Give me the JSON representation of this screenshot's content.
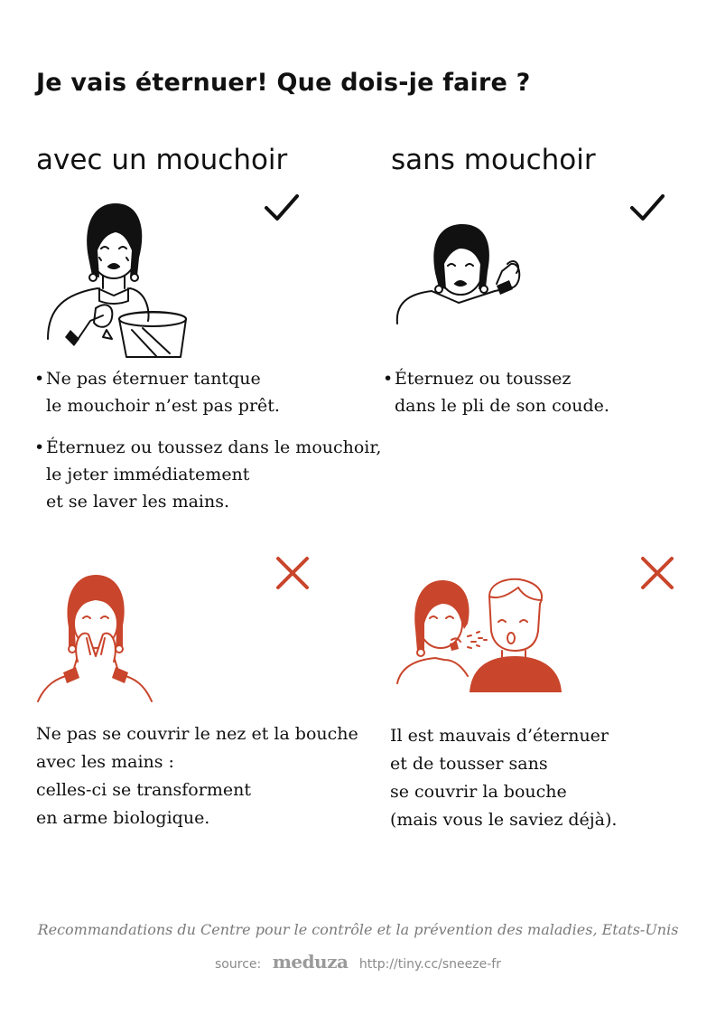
{
  "title": "Je vais éternuer! Que dois-je faire ?",
  "colors": {
    "ink": "#111111",
    "accent": "#c9452b",
    "muted": "#7a7a7a"
  },
  "with_tissue": {
    "heading": "avec un mouchoir",
    "mark_icon": "checkmark-icon",
    "illustration_icon": "woman-sneezing-holding-tissue-over-bin-icon",
    "tips": [
      {
        "line1": "Ne pas éternuer tantque",
        "line2": "le mouchoir n’est pas prêt."
      },
      {
        "line1": "Éternuez ou toussez dans le mouchoir,",
        "line2": "le jeter immédiatement",
        "line3": "et se laver les mains."
      }
    ]
  },
  "without_tissue": {
    "heading": "sans mouchoir",
    "mark_icon": "checkmark-icon",
    "illustration_icon": "woman-sneezing-into-elbow-icon",
    "tips": [
      {
        "line1": "Éternuez ou toussez",
        "line2": "dans le pli de son coude."
      }
    ]
  },
  "wrong_hands": {
    "mark_icon": "cross-icon",
    "illustration_icon": "woman-sneezing-into-hands-icon",
    "text": {
      "line1": "Ne pas se couvrir le nez et la bouche",
      "line2": "avec les mains :",
      "line3": "celles-ci se transforment",
      "line4": "en arme biologique."
    }
  },
  "wrong_uncovered": {
    "mark_icon": "cross-icon",
    "illustration_icon": "woman-sneezing-on-man-icon",
    "text": {
      "line1": "Il est mauvais d’éternuer",
      "line2": "et de tousser sans",
      "line3": "se couvrir la bouche",
      "line4": "(mais vous le saviez déjà)."
    }
  },
  "footer": {
    "note": "Recommandations du Centre pour le contrôle et la prévention des maladies, Etats-Unis",
    "source_label": "source:",
    "brand": "meduza",
    "url": "http://tiny.cc/sneeze-fr"
  }
}
